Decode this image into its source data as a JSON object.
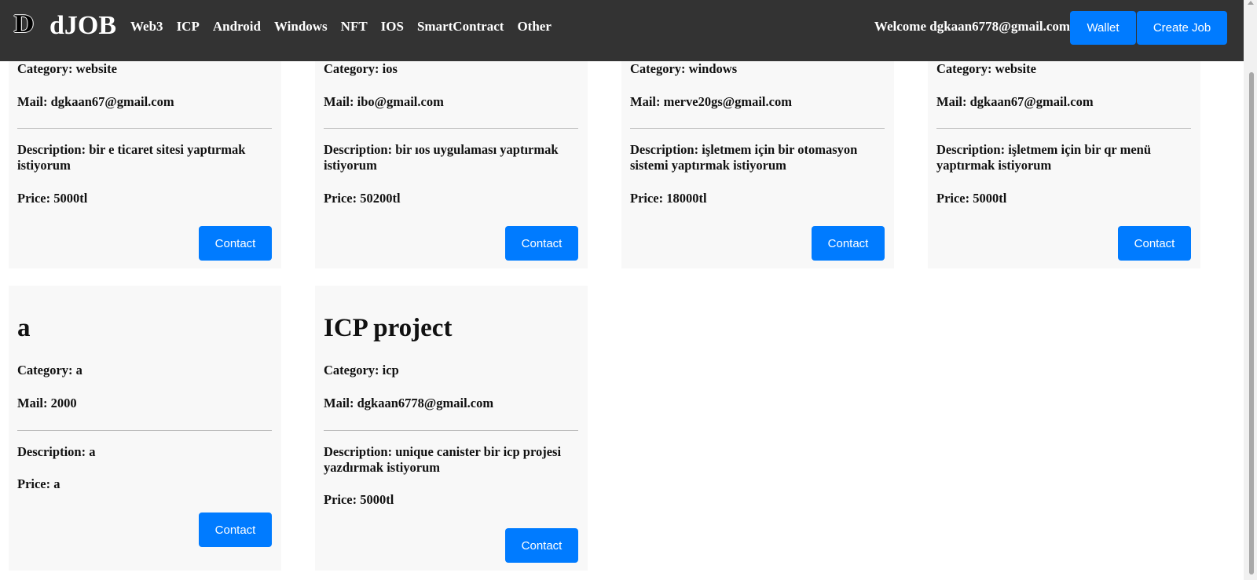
{
  "navbar": {
    "logo_letter": "D",
    "brand": "dJOB",
    "links": [
      "Web3",
      "ICP",
      "Android",
      "Windows",
      "NFT",
      "IOS",
      "SmartContract",
      "Other"
    ],
    "welcome": "Welcome dgkaan6778@gmail.com",
    "wallet_label": "Wallet",
    "create_job_label": "Create Job"
  },
  "jobs": [
    {
      "category": "Category: website",
      "mail": "Mail: dgkaan67@gmail.com",
      "description": "Description: bir e ticaret sitesi yaptırmak istiyorum",
      "price": "Price: 5000tl",
      "contact_label": "Contact"
    },
    {
      "category": "Category: ios",
      "mail": "Mail: ibo@gmail.com",
      "description": "Description: bir ıos uygulaması yaptırmak istiyorum",
      "price": "Price: 50200tl",
      "contact_label": "Contact"
    },
    {
      "category": "Category: windows",
      "mail": "Mail: merve20gs@gmail.com",
      "description": "Description: işletmem için bir otomasyon sistemi yaptırmak istiyorum",
      "price": "Price: 18000tl",
      "contact_label": "Contact"
    },
    {
      "category": "Category: website",
      "mail": "Mail: dgkaan67@gmail.com",
      "description": "Description: işletmem için bir qr menü yaptırmak istiyorum",
      "price": "Price: 5000tl",
      "contact_label": "Contact"
    },
    {
      "title": "a",
      "category": "Category: a",
      "mail": "Mail: 2000",
      "description": "Description: a",
      "price": "Price: a",
      "contact_label": "Contact"
    },
    {
      "title": "ICP project",
      "category": "Category: icp",
      "mail": "Mail: dgkaan6778@gmail.com",
      "description": "Description: unique canister bir icp projesi yazdırmak istiyorum",
      "price": "Price: 5000tl",
      "contact_label": "Contact"
    }
  ],
  "colors": {
    "navbar_bg": "#333333",
    "accent": "#007bff",
    "card_bg": "#f8f8f8"
  }
}
